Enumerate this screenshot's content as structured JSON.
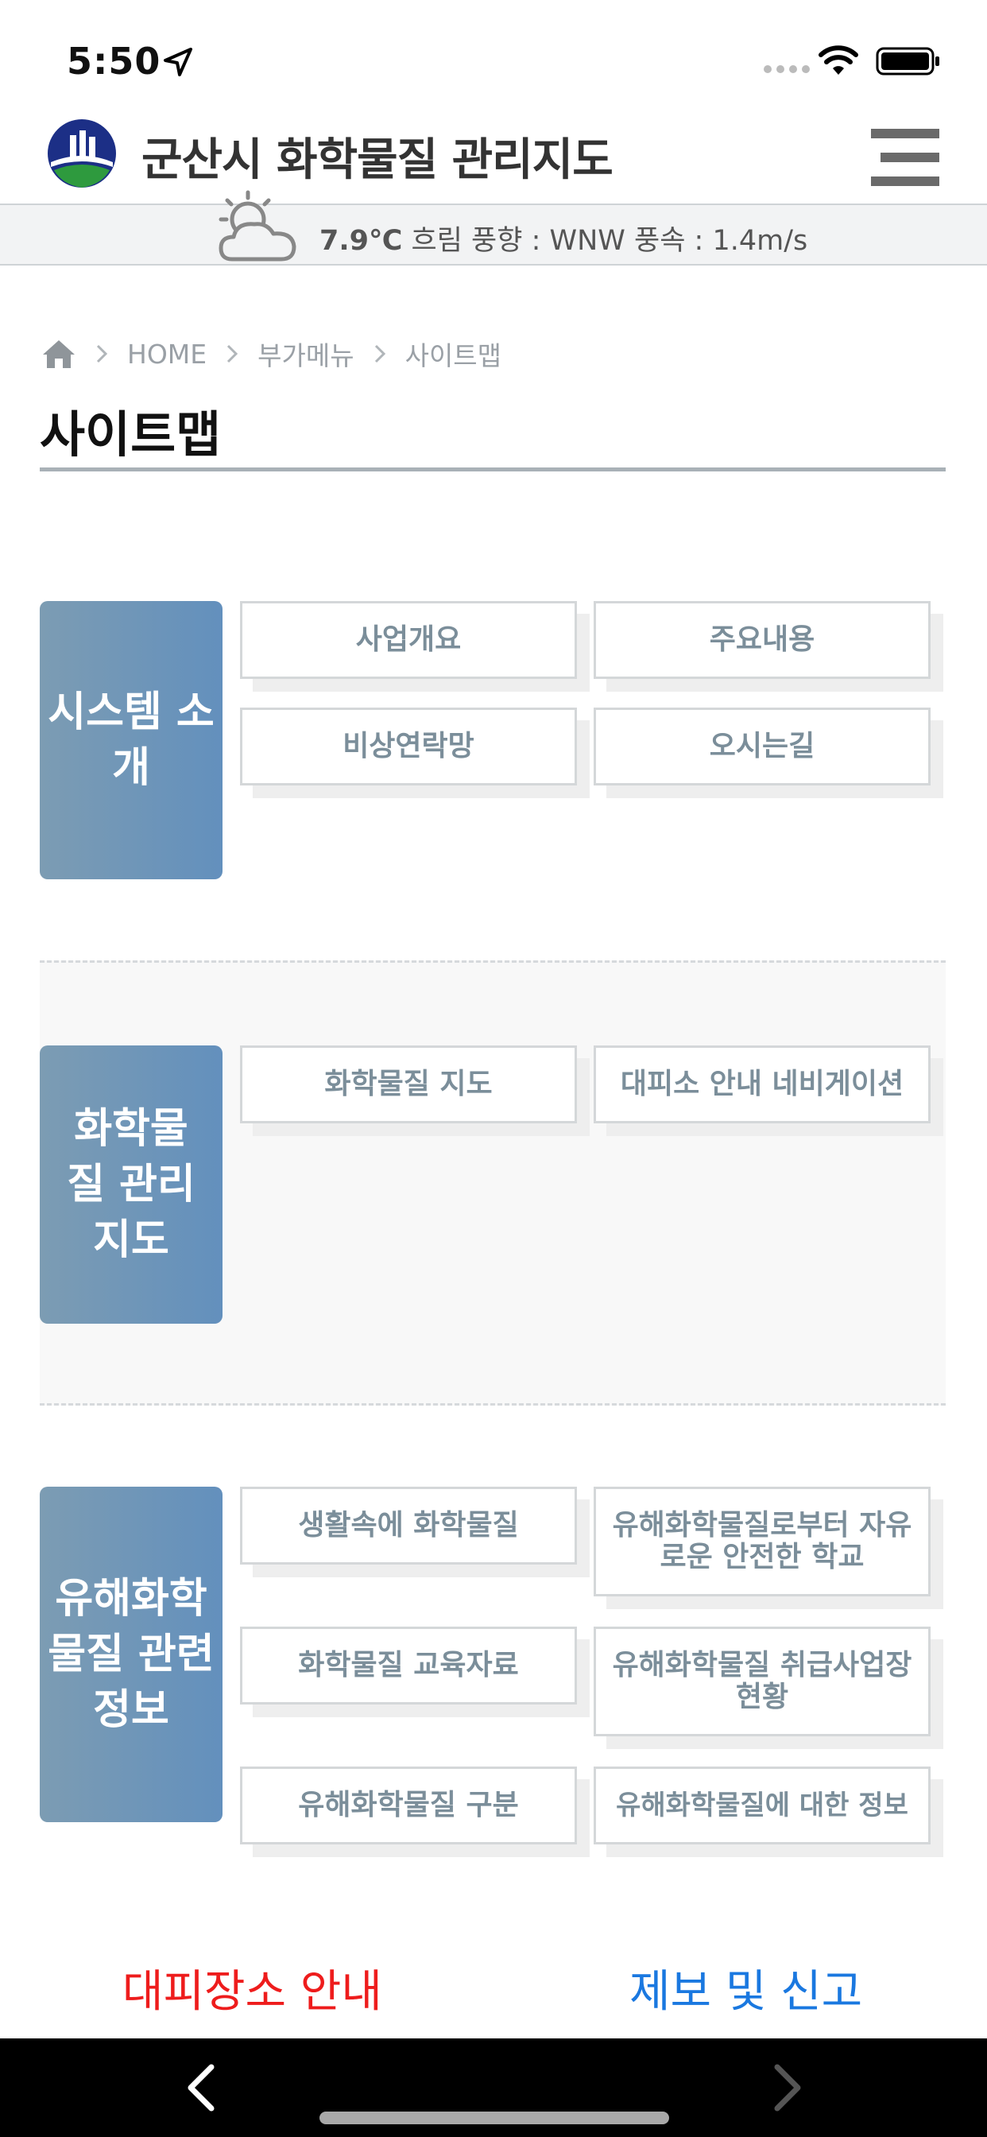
{
  "status_bar": {
    "time": "5:50"
  },
  "header": {
    "title": "군산시 화학물질 관리지도"
  },
  "weather": {
    "temperature": "7.9℃",
    "details": " 흐림 풍향 : WNW 풍속 : 1.4m/s"
  },
  "breadcrumb": [
    "HOME",
    "부가메뉴",
    "사이트맵"
  ],
  "page_title": "사이트맵",
  "sections": [
    {
      "category": "시스템 소개",
      "items": [
        "사업개요",
        "주요내용",
        "비상연락망",
        "오시는길"
      ]
    },
    {
      "category": "화학물질 관리지도",
      "items": [
        "화학물질 지도",
        "대피소 안내 네비게이션"
      ]
    },
    {
      "category": "유해화학물질 관련 정보",
      "items": [
        "생활속에 화학물질",
        "유해화학물질로부터 자유로운 안전한 학교",
        "화학물질 교육자료",
        "유해화학물질 취급사업장 현황",
        "유해화학물질 구분",
        "유해화학물질에 대한 정보"
      ]
    }
  ],
  "bottom_links": {
    "evacuation": "대피장소 안내",
    "report": "제보 및 신고"
  },
  "colors": {
    "category_bg": "#6f96b8",
    "evacuation": "#ee1c1c",
    "report": "#1a78e0",
    "item_text": "#7b8e9a"
  }
}
